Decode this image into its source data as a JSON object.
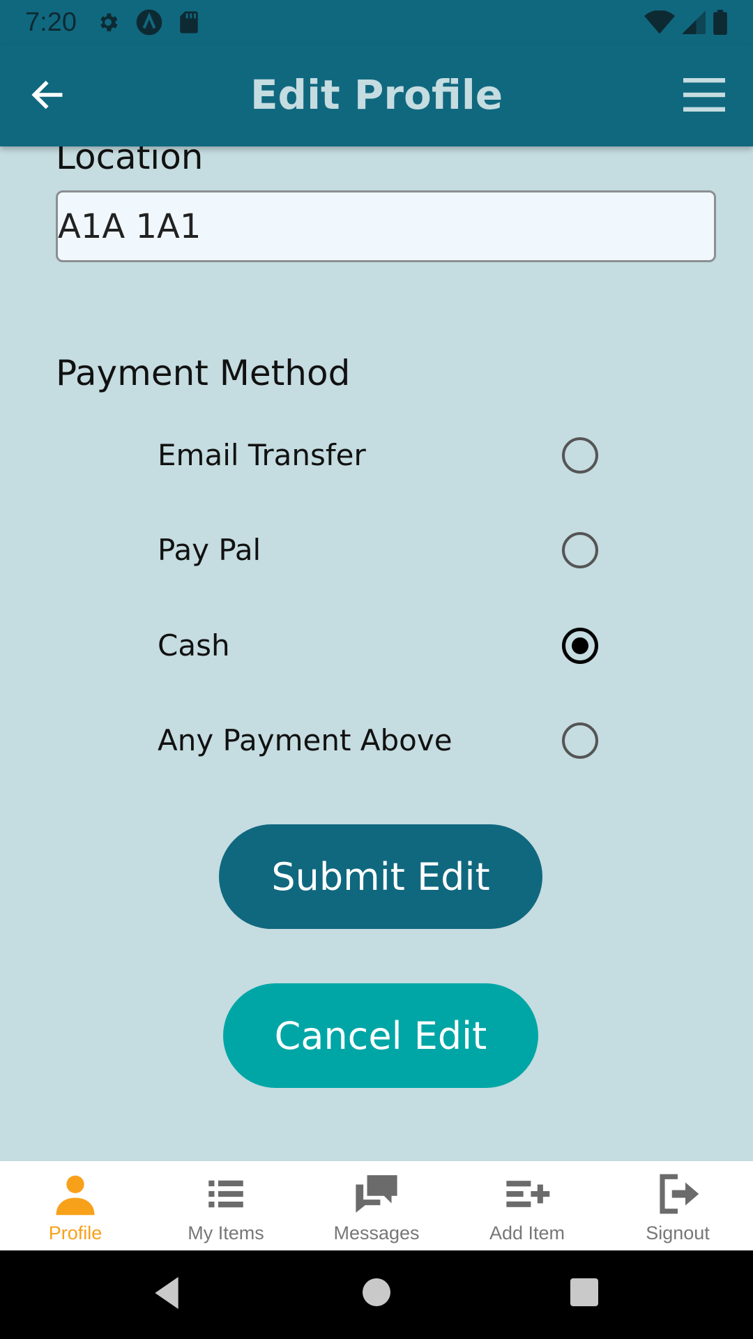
{
  "status_bar": {
    "time": "7:20",
    "icons_left": [
      "gear-icon",
      "a-icon",
      "sd-card-icon"
    ],
    "icons_right": [
      "wifi-icon",
      "signal-icon",
      "battery-icon"
    ]
  },
  "app_bar": {
    "title": "Edit Profile",
    "back_icon": "arrow-left-icon",
    "menu_icon": "hamburger-menu-icon",
    "background": "#10687f"
  },
  "form": {
    "location_label": "Location",
    "location_value": "A1A 1A1",
    "payment_label": "Payment Method",
    "payment_options": [
      {
        "label": "Email Transfer",
        "checked": false
      },
      {
        "label": "Pay Pal",
        "checked": false
      },
      {
        "label": "Cash",
        "checked": true
      },
      {
        "label": "Any Payment Above",
        "checked": false
      }
    ],
    "submit_label": "Submit Edit",
    "cancel_label": "Cancel Edit"
  },
  "bottom_nav": {
    "items": [
      {
        "label": "Profile",
        "icon": "person-icon",
        "active": true
      },
      {
        "label": "My Items",
        "icon": "list-icon",
        "active": false
      },
      {
        "label": "Messages",
        "icon": "chat-icon",
        "active": false
      },
      {
        "label": "Add Item",
        "icon": "add-list-icon",
        "active": false
      },
      {
        "label": "Signout",
        "icon": "signout-icon",
        "active": false
      }
    ]
  },
  "colors": {
    "primary": "#10687f",
    "accent": "#00a6a6",
    "background": "#c5dce0",
    "active_nav": "#f7a11a"
  }
}
